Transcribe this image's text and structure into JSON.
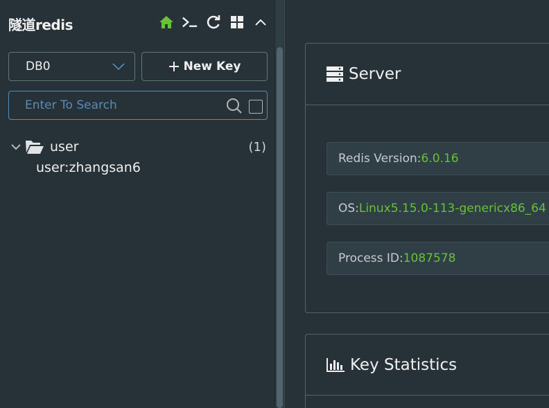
{
  "app": {
    "title": "隧道redis"
  },
  "toolbar": {
    "icons": [
      "home-icon",
      "terminal-icon",
      "refresh-icon",
      "grid-icon",
      "collapse-icon"
    ]
  },
  "db_select": {
    "value": "DB0"
  },
  "new_key": {
    "label": "New Key"
  },
  "search": {
    "placeholder": "Enter To Search"
  },
  "tree": {
    "folder": {
      "name": "user",
      "count": "(1)"
    },
    "keys": [
      "user:zhangsan6"
    ]
  },
  "server": {
    "title": "Server",
    "rows": [
      {
        "label": "Redis Version: ",
        "value": "6.0.16"
      },
      {
        "label": "OS: ",
        "value": "Linux5.15.0-113-genericx86_64"
      },
      {
        "label": "Process ID: ",
        "value": "1087578"
      }
    ]
  },
  "key_stats": {
    "title": "Key Statistics"
  },
  "colors": {
    "value_green": "#67c23a",
    "home_green": "#67c23a",
    "placeholder_blue": "#5a8bb8",
    "background": "#263238"
  }
}
